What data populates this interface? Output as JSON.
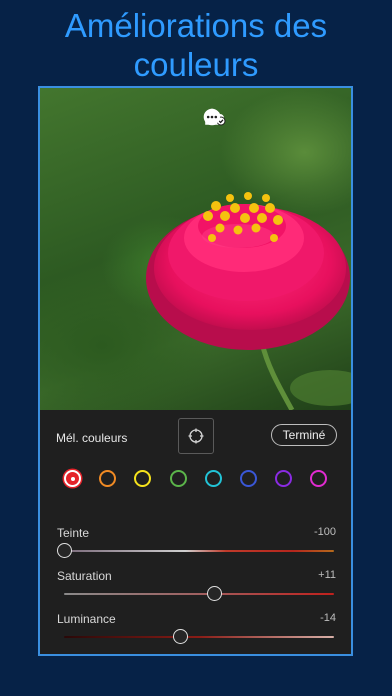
{
  "headline": {
    "line1": "Améliorations des",
    "line2": "couleurs"
  },
  "toolbar": {
    "icons": [
      "help-icon",
      "share-icon",
      "cloud-sync-icon",
      "more-icon"
    ]
  },
  "color_mix": {
    "label": "Mél. couleurs",
    "target_tool": "target-icon",
    "done_label": "Terminé",
    "swatches": [
      {
        "name": "red",
        "color": "#e5232a",
        "selected": true
      },
      {
        "name": "orange",
        "color": "#f08a24",
        "selected": false
      },
      {
        "name": "yellow",
        "color": "#f5e21c",
        "selected": false
      },
      {
        "name": "green",
        "color": "#5bb44a",
        "selected": false
      },
      {
        "name": "aqua",
        "color": "#22c3d6",
        "selected": false
      },
      {
        "name": "blue",
        "color": "#3a57d6",
        "selected": false
      },
      {
        "name": "purple",
        "color": "#8a2be2",
        "selected": false
      },
      {
        "name": "magenta",
        "color": "#e02bd0",
        "selected": false
      }
    ],
    "sliders": [
      {
        "label": "Teinte",
        "value": "-100",
        "position": 0.0
      },
      {
        "label": "Saturation",
        "value": "+11",
        "position": 0.555
      },
      {
        "label": "Luminance",
        "value": "-14",
        "position": 0.43
      }
    ]
  }
}
